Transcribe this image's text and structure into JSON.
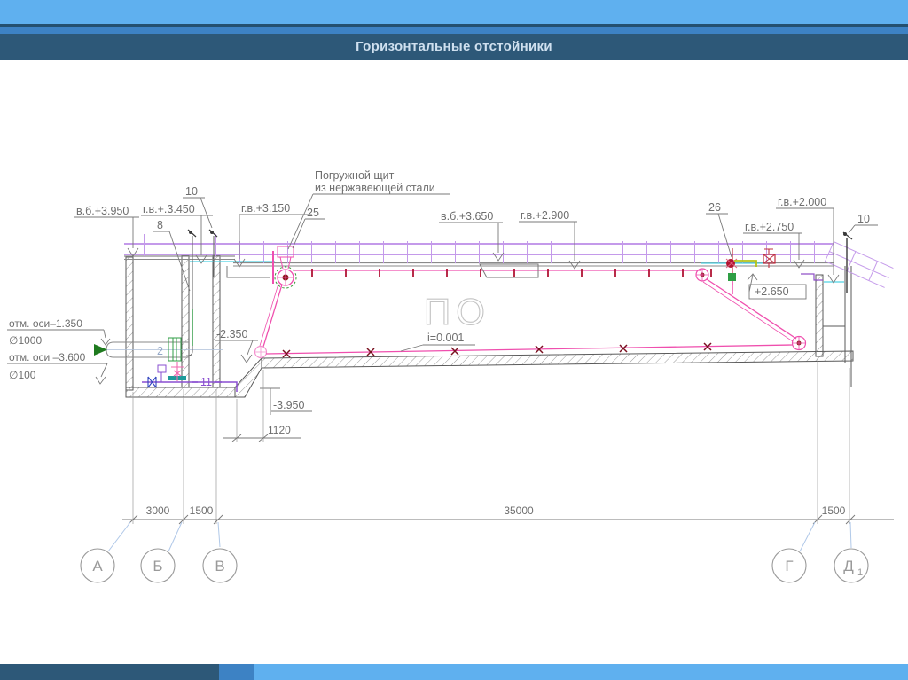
{
  "slide": {
    "title": "Горизонтальные отстойники"
  },
  "drawing": {
    "watermark": "ПО",
    "note_line1": "Погружной щит",
    "note_line2": "из нержавеющей стали",
    "levels": {
      "vb3950": "в.б.+3.950",
      "gv3450": "г.в.+.3.450",
      "gv3150": "г.в.+3.150",
      "vb3650": "в.б.+3.650",
      "gv2900": "г.в.+2.900",
      "gv2000": "г.в.+2.000",
      "gv2750": "г.в.+2.750",
      "p2650": "+2.650",
      "m2350": "-2.350",
      "m3950": "-3.950"
    },
    "slope": "i=0.001",
    "callouts": {
      "c10_left": "10",
      "c8": "8",
      "c25": "25",
      "c2": "2",
      "c11": "11",
      "c26": "26",
      "c10_right": "10"
    },
    "inlet": {
      "axis_mark_1": "отм. оси–1.350",
      "dia_1": "∅1000",
      "axis_mark_2": "отм. оси –3.600",
      "dia_2": "∅100"
    },
    "dims": {
      "span_ab": "3000",
      "span_bv": "1500",
      "span_vg": "35000",
      "span_gd": "1500",
      "slope_run": "1120"
    },
    "axes": {
      "a": "А",
      "b": "Б",
      "v": "В",
      "g": "Г",
      "d": "Д",
      "d_index": "1"
    }
  }
}
